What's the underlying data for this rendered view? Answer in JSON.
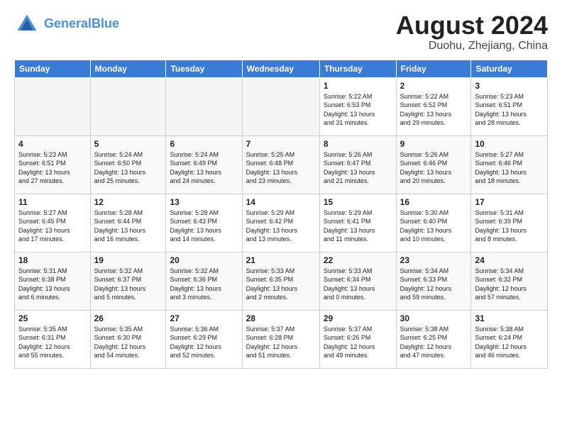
{
  "header": {
    "logo_line1": "General",
    "logo_line2": "Blue",
    "month": "August 2024",
    "location": "Duohu, Zhejiang, China"
  },
  "weekdays": [
    "Sunday",
    "Monday",
    "Tuesday",
    "Wednesday",
    "Thursday",
    "Friday",
    "Saturday"
  ],
  "weeks": [
    [
      {
        "day": "",
        "info": ""
      },
      {
        "day": "",
        "info": ""
      },
      {
        "day": "",
        "info": ""
      },
      {
        "day": "",
        "info": ""
      },
      {
        "day": "1",
        "info": "Sunrise: 5:22 AM\nSunset: 6:53 PM\nDaylight: 13 hours\nand 31 minutes."
      },
      {
        "day": "2",
        "info": "Sunrise: 5:22 AM\nSunset: 6:52 PM\nDaylight: 13 hours\nand 29 minutes."
      },
      {
        "day": "3",
        "info": "Sunrise: 5:23 AM\nSunset: 6:51 PM\nDaylight: 13 hours\nand 28 minutes."
      }
    ],
    [
      {
        "day": "4",
        "info": "Sunrise: 5:23 AM\nSunset: 6:51 PM\nDaylight: 13 hours\nand 27 minutes."
      },
      {
        "day": "5",
        "info": "Sunrise: 5:24 AM\nSunset: 6:50 PM\nDaylight: 13 hours\nand 25 minutes."
      },
      {
        "day": "6",
        "info": "Sunrise: 5:24 AM\nSunset: 6:49 PM\nDaylight: 13 hours\nand 24 minutes."
      },
      {
        "day": "7",
        "info": "Sunrise: 5:25 AM\nSunset: 6:48 PM\nDaylight: 13 hours\nand 23 minutes."
      },
      {
        "day": "8",
        "info": "Sunrise: 5:26 AM\nSunset: 6:47 PM\nDaylight: 13 hours\nand 21 minutes."
      },
      {
        "day": "9",
        "info": "Sunrise: 5:26 AM\nSunset: 6:46 PM\nDaylight: 13 hours\nand 20 minutes."
      },
      {
        "day": "10",
        "info": "Sunrise: 5:27 AM\nSunset: 6:46 PM\nDaylight: 13 hours\nand 18 minutes."
      }
    ],
    [
      {
        "day": "11",
        "info": "Sunrise: 5:27 AM\nSunset: 6:45 PM\nDaylight: 13 hours\nand 17 minutes."
      },
      {
        "day": "12",
        "info": "Sunrise: 5:28 AM\nSunset: 6:44 PM\nDaylight: 13 hours\nand 16 minutes."
      },
      {
        "day": "13",
        "info": "Sunrise: 5:28 AM\nSunset: 6:43 PM\nDaylight: 13 hours\nand 14 minutes."
      },
      {
        "day": "14",
        "info": "Sunrise: 5:29 AM\nSunset: 6:42 PM\nDaylight: 13 hours\nand 13 minutes."
      },
      {
        "day": "15",
        "info": "Sunrise: 5:29 AM\nSunset: 6:41 PM\nDaylight: 13 hours\nand 11 minutes."
      },
      {
        "day": "16",
        "info": "Sunrise: 5:30 AM\nSunset: 6:40 PM\nDaylight: 13 hours\nand 10 minutes."
      },
      {
        "day": "17",
        "info": "Sunrise: 5:31 AM\nSunset: 6:39 PM\nDaylight: 13 hours\nand 8 minutes."
      }
    ],
    [
      {
        "day": "18",
        "info": "Sunrise: 5:31 AM\nSunset: 6:38 PM\nDaylight: 13 hours\nand 6 minutes."
      },
      {
        "day": "19",
        "info": "Sunrise: 5:32 AM\nSunset: 6:37 PM\nDaylight: 13 hours\nand 5 minutes."
      },
      {
        "day": "20",
        "info": "Sunrise: 5:32 AM\nSunset: 6:36 PM\nDaylight: 13 hours\nand 3 minutes."
      },
      {
        "day": "21",
        "info": "Sunrise: 5:33 AM\nSunset: 6:35 PM\nDaylight: 13 hours\nand 2 minutes."
      },
      {
        "day": "22",
        "info": "Sunrise: 5:33 AM\nSunset: 6:34 PM\nDaylight: 13 hours\nand 0 minutes."
      },
      {
        "day": "23",
        "info": "Sunrise: 5:34 AM\nSunset: 6:33 PM\nDaylight: 12 hours\nand 59 minutes."
      },
      {
        "day": "24",
        "info": "Sunrise: 5:34 AM\nSunset: 6:32 PM\nDaylight: 12 hours\nand 57 minutes."
      }
    ],
    [
      {
        "day": "25",
        "info": "Sunrise: 5:35 AM\nSunset: 6:31 PM\nDaylight: 12 hours\nand 55 minutes."
      },
      {
        "day": "26",
        "info": "Sunrise: 5:35 AM\nSunset: 6:30 PM\nDaylight: 12 hours\nand 54 minutes."
      },
      {
        "day": "27",
        "info": "Sunrise: 5:36 AM\nSunset: 6:29 PM\nDaylight: 12 hours\nand 52 minutes."
      },
      {
        "day": "28",
        "info": "Sunrise: 5:37 AM\nSunset: 6:28 PM\nDaylight: 12 hours\nand 51 minutes."
      },
      {
        "day": "29",
        "info": "Sunrise: 5:37 AM\nSunset: 6:26 PM\nDaylight: 12 hours\nand 49 minutes."
      },
      {
        "day": "30",
        "info": "Sunrise: 5:38 AM\nSunset: 6:25 PM\nDaylight: 12 hours\nand 47 minutes."
      },
      {
        "day": "31",
        "info": "Sunrise: 5:38 AM\nSunset: 6:24 PM\nDaylight: 12 hours\nand 46 minutes."
      }
    ]
  ]
}
